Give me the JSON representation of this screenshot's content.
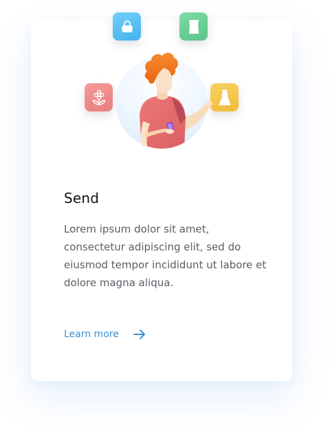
{
  "card": {
    "title": "Send",
    "description": "Lorem ipsum dolor sit amet, consectetur adipiscing elit, sed do eiusmod tempor incididunt ut labore et dolore magna aliqua.",
    "link_label": "Learn more"
  },
  "illustration": {
    "tiles": [
      {
        "icon": "handbag-icon",
        "color": "#5bc3f3"
      },
      {
        "icon": "shirt-icon",
        "color": "#6fcf97"
      },
      {
        "icon": "flower-icon",
        "color": "#f08a8a"
      },
      {
        "icon": "dress-icon",
        "color": "#f5c64b"
      }
    ],
    "colors": {
      "hair": "#f4761e",
      "skin": "#fbe1c7",
      "shirt": "#e8706e",
      "phone": "#8a4fd6"
    }
  },
  "colors": {
    "accent": "#3a8fd2",
    "title": "#111111",
    "text": "#5c5c66"
  }
}
